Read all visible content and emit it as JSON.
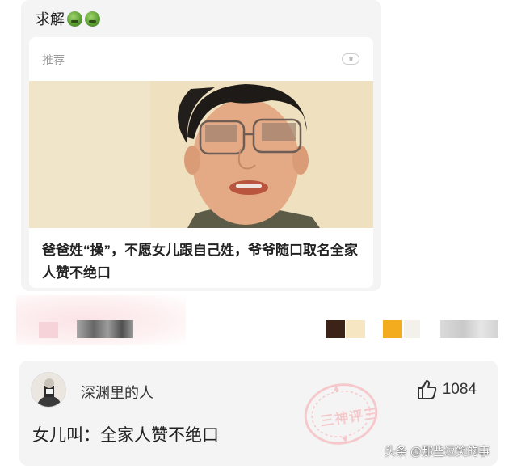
{
  "post": {
    "title": "求解",
    "emoji_icon": "smiling-frog-emoji-icon"
  },
  "recommend_card": {
    "label": "推荐",
    "close_icon": "close-pill-icon",
    "headline": "爸爸姓“操”，不愿女儿跟自己姓，爷爷随口取名全家人赞不绝口"
  },
  "comment": {
    "username": "深渊里的人",
    "like_count": "1084",
    "like_icon": "thumbs-up-icon",
    "text": "女儿叫：全家人赞不绝口",
    "stamp_text": "三神评三"
  },
  "watermark": "头条 @那些逗笑的事",
  "colors": {
    "card_bg": "#f4f4f4",
    "stamp_pink": "#f6c2c6"
  }
}
